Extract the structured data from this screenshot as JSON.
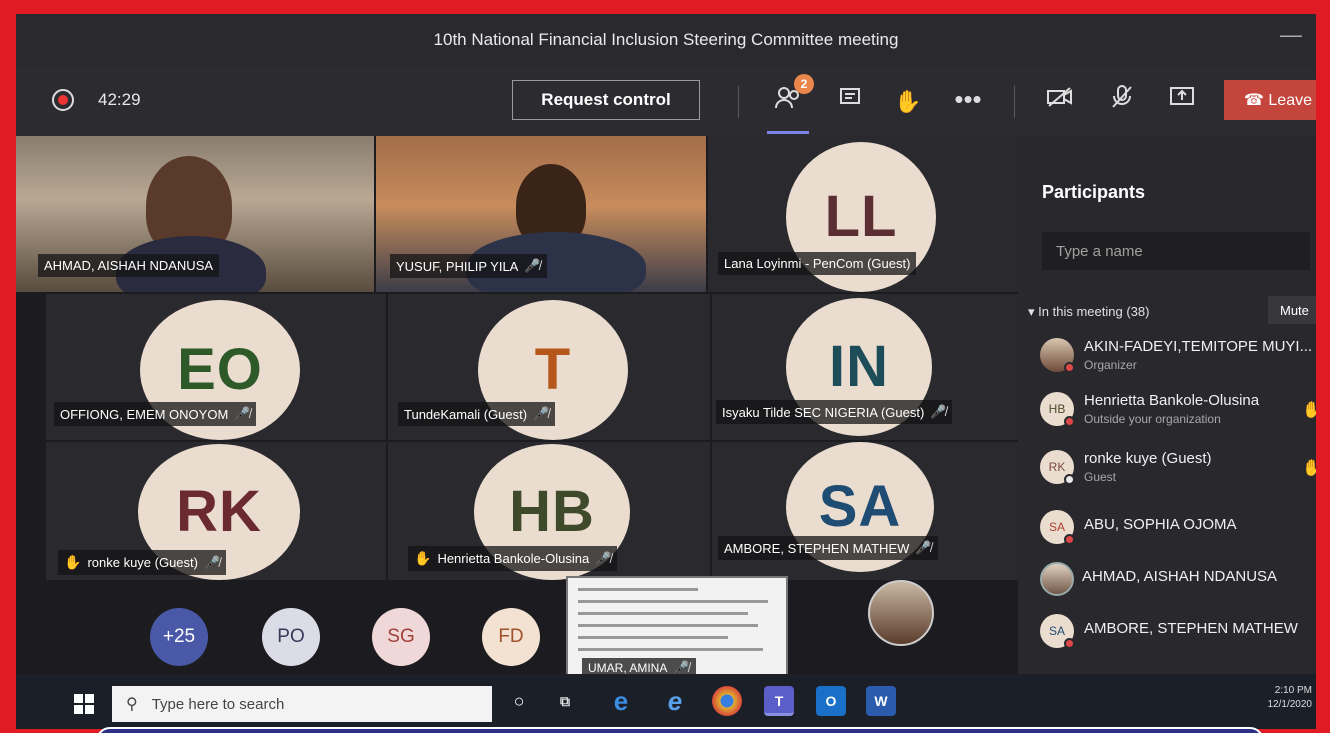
{
  "window": {
    "title": "10th National Financial Inclusion Steering Committee meeting"
  },
  "toolbar": {
    "timer": "42:29",
    "request_control_label": "Request control",
    "people_badge": "2",
    "leave_label": "Leave"
  },
  "colors": {
    "accent": "#7b83eb",
    "leave": "#c4453b",
    "frame": "#e01b24",
    "taskbar": "#1a1f28",
    "badge": "#e8864b"
  },
  "tiles": {
    "t1": {
      "name": "AHMAD, AISHAH NDANUSA"
    },
    "t2": {
      "name": "YUSUF, PHILIP YILA"
    },
    "t3": {
      "initials": "LL",
      "name": "Lana Loyinmi - PenCom (Guest)"
    },
    "t4": {
      "initials": "EO",
      "name": "OFFIONG, EMEM ONOYOM"
    },
    "t5": {
      "initials": "T",
      "name": "TundeKamali (Guest)"
    },
    "t6": {
      "initials": "IN",
      "name": "Isyaku Tilde SEC NIGERIA (Guest)"
    },
    "t7": {
      "initials": "RK",
      "name": "ronke kuye (Guest)"
    },
    "t8": {
      "initials": "HB",
      "name": "Henrietta Bankole-Olusina"
    },
    "t9": {
      "initials": "SA",
      "name": "AMBORE, STEPHEN MATHEW"
    }
  },
  "overflow": {
    "more": "+25",
    "po": "PO",
    "sg": "SG",
    "fd": "FD"
  },
  "screen_share": {
    "name": "UMAR, AMINA"
  },
  "panel": {
    "title": "Participants",
    "search_placeholder": "Type a name",
    "section": "In this meeting (38)",
    "mute_all": "Mute",
    "people": [
      {
        "initials": "",
        "name": "AKIN-FADEYI,TEMITOPE MUYI...",
        "sub": "Organizer"
      },
      {
        "initials": "HB",
        "name": "Henrietta Bankole-Olusina",
        "sub": "Outside your organization"
      },
      {
        "initials": "RK",
        "name": "ronke kuye (Guest)",
        "sub": "Guest"
      },
      {
        "initials": "SA",
        "name": "ABU, SOPHIA OJOMA",
        "sub": ""
      },
      {
        "initials": "",
        "name": "AHMAD, AISHAH NDANUSA",
        "sub": ""
      },
      {
        "initials": "SA",
        "name": "AMBORE, STEPHEN MATHEW",
        "sub": ""
      }
    ]
  },
  "taskbar": {
    "search_placeholder": "Type here to search",
    "time": "2:10 PM",
    "date": "12/1/2020"
  }
}
